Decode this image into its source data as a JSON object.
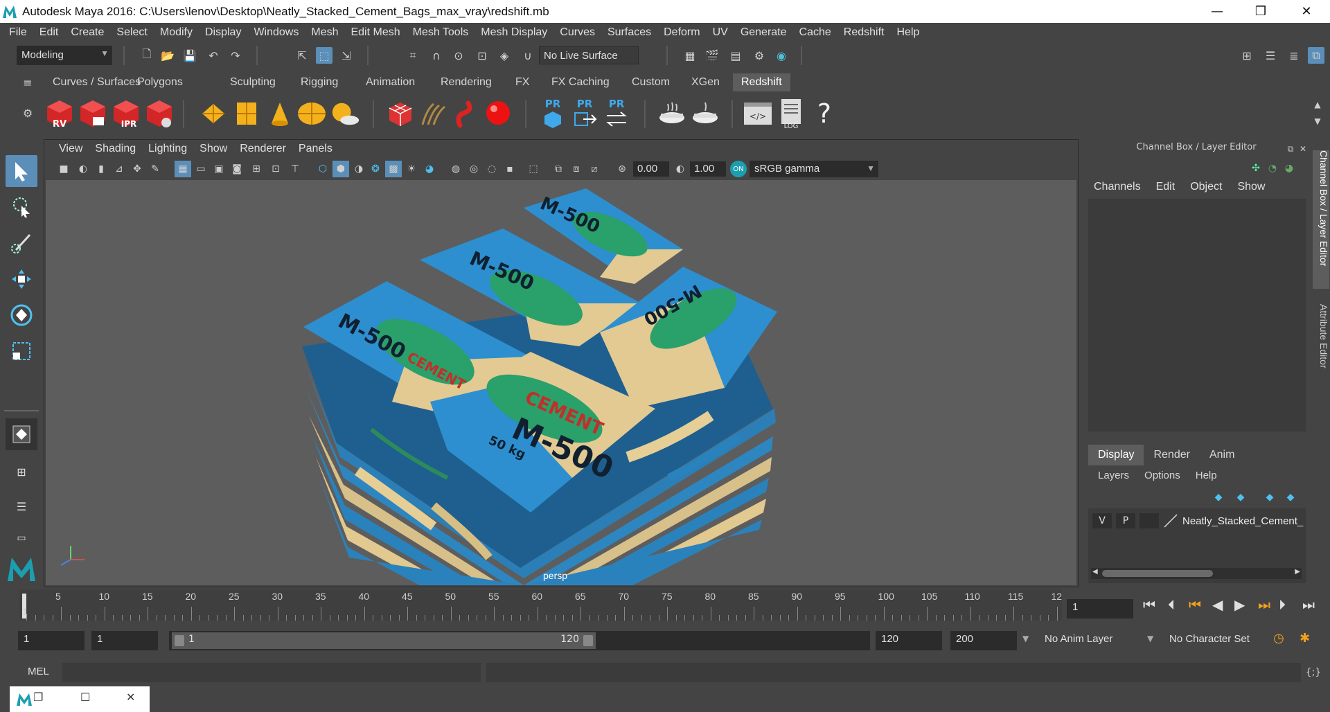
{
  "window": {
    "title": "Autodesk Maya 2016: C:\\Users\\lenov\\Desktop\\Neatly_Stacked_Cement_Bags_max_vray\\redshift.mb"
  },
  "menubar": [
    "File",
    "Edit",
    "Create",
    "Select",
    "Modify",
    "Display",
    "Windows",
    "Mesh",
    "Edit Mesh",
    "Mesh Tools",
    "Mesh Display",
    "Curves",
    "Surfaces",
    "Deform",
    "UV",
    "Generate",
    "Cache",
    "Redshift",
    "Help"
  ],
  "statusline": {
    "mode": "Modeling",
    "live_surface": "No Live Surface"
  },
  "shelf_tabs": [
    "Curves / Surfaces",
    "Polygons",
    "Sculpting",
    "Rigging",
    "Animation",
    "Rendering",
    "FX",
    "FX Caching",
    "Custom",
    "XGen",
    "Redshift"
  ],
  "shelf_active": "Redshift",
  "shelf_icons": {
    "rv": "RV",
    "ipr": "IPR",
    "pr": "PR",
    "log": "LOG",
    "help": "?"
  },
  "viewport": {
    "menu": [
      "View",
      "Shading",
      "Lighting",
      "Show",
      "Renderer",
      "Panels"
    ],
    "exposure": "0.00",
    "gamma": "1.00",
    "color_space": "sRGB gamma",
    "camera": "persp",
    "bag_labels": {
      "model": "M-500",
      "weight": "50 kg",
      "product": "CEMENT"
    }
  },
  "channel_box": {
    "title": "Channel Box / Layer Editor",
    "menu": [
      "Channels",
      "Edit",
      "Object",
      "Show"
    ],
    "layer_tabs": [
      "Display",
      "Render",
      "Anim"
    ],
    "layer_menu": [
      "Layers",
      "Options",
      "Help"
    ],
    "layer": {
      "v": "V",
      "p": "P",
      "name": "Neatly_Stacked_Cement_"
    }
  },
  "side_tabs": [
    "Channel Box / Layer Editor",
    "Attribute Editor"
  ],
  "timeline": {
    "ticks": [
      "5",
      "10",
      "15",
      "20",
      "25",
      "30",
      "35",
      "40",
      "45",
      "50",
      "55",
      "60",
      "65",
      "70",
      "75",
      "80",
      "85",
      "90",
      "95",
      "100",
      "105",
      "110",
      "115",
      "12"
    ],
    "current_marker": "1",
    "current_frame": "1"
  },
  "range": {
    "start": "1",
    "playback_start": "1",
    "slider_start": "1",
    "slider_end": "120",
    "playback_end": "120",
    "end": "200",
    "anim_layer": "No Anim Layer",
    "character_set": "No Character Set"
  },
  "cmdline": {
    "label": "MEL"
  }
}
